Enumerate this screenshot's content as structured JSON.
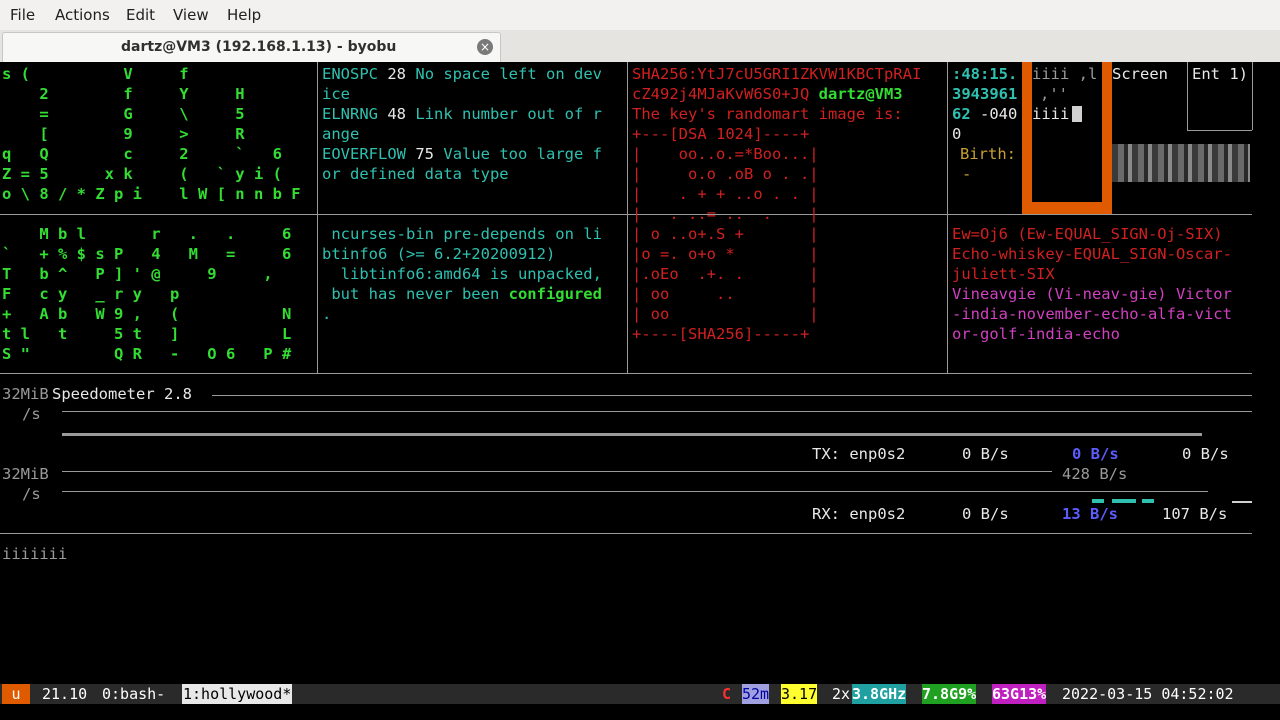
{
  "menu": {
    "file": "File",
    "actions": "Actions",
    "edit": "Edit",
    "view": "View",
    "help": "Help"
  },
  "tab": {
    "title": "dartz@VM3 (192.168.1.13) - byobu"
  },
  "matrix_top": [
    "s (          V     f",
    "    2        f     Y     H",
    "    =        G     \\     5",
    "    [        9     >     R",
    "q   Q        c     2     `   6",
    "Z = 5      x k     (   ` y i (",
    "o \\ 8 / * Z p i    l W [ n n b F"
  ],
  "matrix_bottom": [
    "    M b l       r   .   .     6",
    "`   + % $ s P   4   M   =     6",
    "T   b ^   P ] ' @     9     ,",
    "F   c y   _ r y   p",
    "+   A b   W 9 ,   (           N",
    "t l   t     5 t   ]           L",
    "S \"         Q R   -   O 6   P #"
  ],
  "errno_lines": [
    {
      "name": "ENOSPC",
      "num": "28",
      "desc": "No space left on dev",
      "cont": "ice"
    },
    {
      "name": "ELNRNG",
      "num": "48",
      "desc": "Link number out of r",
      "cont": "ange"
    },
    {
      "name": "EOVERFLOW",
      "num": "75",
      "desc": "Value too large f",
      "cont": "or defined data type"
    }
  ],
  "apt_lines": [
    " ncurses-bin pre-depends on li",
    "btinfo6 (>= 6.2+20200912)",
    "  libtinfo6:amd64 is unpacked,",
    " but has never been ",
    "configured",
    "."
  ],
  "randomart": {
    "sha_line1": "SHA256:YtJ7cU5GRI1ZKVW1KBCTpRAI",
    "sha_line2": "cZ492j4MJaKvW6S0+JQ",
    "host": "dartz@VM3",
    "image_line": "The key's randomart image is:",
    "art": [
      "+---[DSA 1024]----+",
      "|    oo..o.=*Boo...|",
      "|     o.o .oB o . .|",
      "|    . + + ..o . . |",
      "|   . ..= ..  .    |",
      "| o ..o+.S +       |",
      "|o =. o+o *        |",
      "|.oEo  .+. .       |",
      "| oo     ..        |",
      "| oo               |",
      "+----[SHA256]-----+"
    ]
  },
  "stat_panel": {
    "time": ":48:15.",
    "inode": "3943961",
    "mode": "62",
    "tz": "-040",
    "zero": "0",
    "birth": "Birth:",
    "dash": "-",
    "iiii1": "iiii ,l",
    "iiii2": "iiii",
    "screen": "Screen",
    "ent": "Ent 1)",
    "quote": ",''"
  },
  "phonetic": {
    "cyan_line": "Ew=Oj6 (Ew-EQUAL_SIGN-Oj-SIX)",
    "red_lines": [
      "Echo-whiskey-EQUAL_SIGN-Oscar-",
      "juliett-SIX"
    ],
    "mg_lines": [
      "Vineavgie (Vi-neav-gie) Victor",
      "-india-november-echo-alfa-vict",
      "or-golf-india-echo"
    ]
  },
  "speedometer": {
    "label_tx_unit": "32MiB",
    "label_tx_s": "/s",
    "title": "Speedometer 2.8",
    "tx_label": "TX: enp0s2",
    "tx_v1": "0 B/s",
    "tx_v2": "0 B/s",
    "tx_v3": "0 B/s",
    "tx_peak": "428 B/s",
    "label_rx_unit": "32MiB",
    "label_rx_s": "/s",
    "rx_label": "RX: enp0s2",
    "rx_v1": "0 B/s",
    "rx_v2": "13 B/s",
    "rx_v3": "107 B/s"
  },
  "prompt_text": "iiiiiii",
  "status": {
    "u": "u",
    "ver": "21.10",
    "win0": "0:bash-",
    "win1": "1:hollywood*",
    "c": "C",
    "uptime": "52m",
    "load": "3.17",
    "cores": "2x",
    "ghz": "3.8GHz",
    "mem": "7.8G9%",
    "disk": "63G13%",
    "datetime": "2022-03-15 04:52:02"
  },
  "colors": {
    "orange": "#e05a00",
    "status_bg": "#2a2a2a"
  }
}
